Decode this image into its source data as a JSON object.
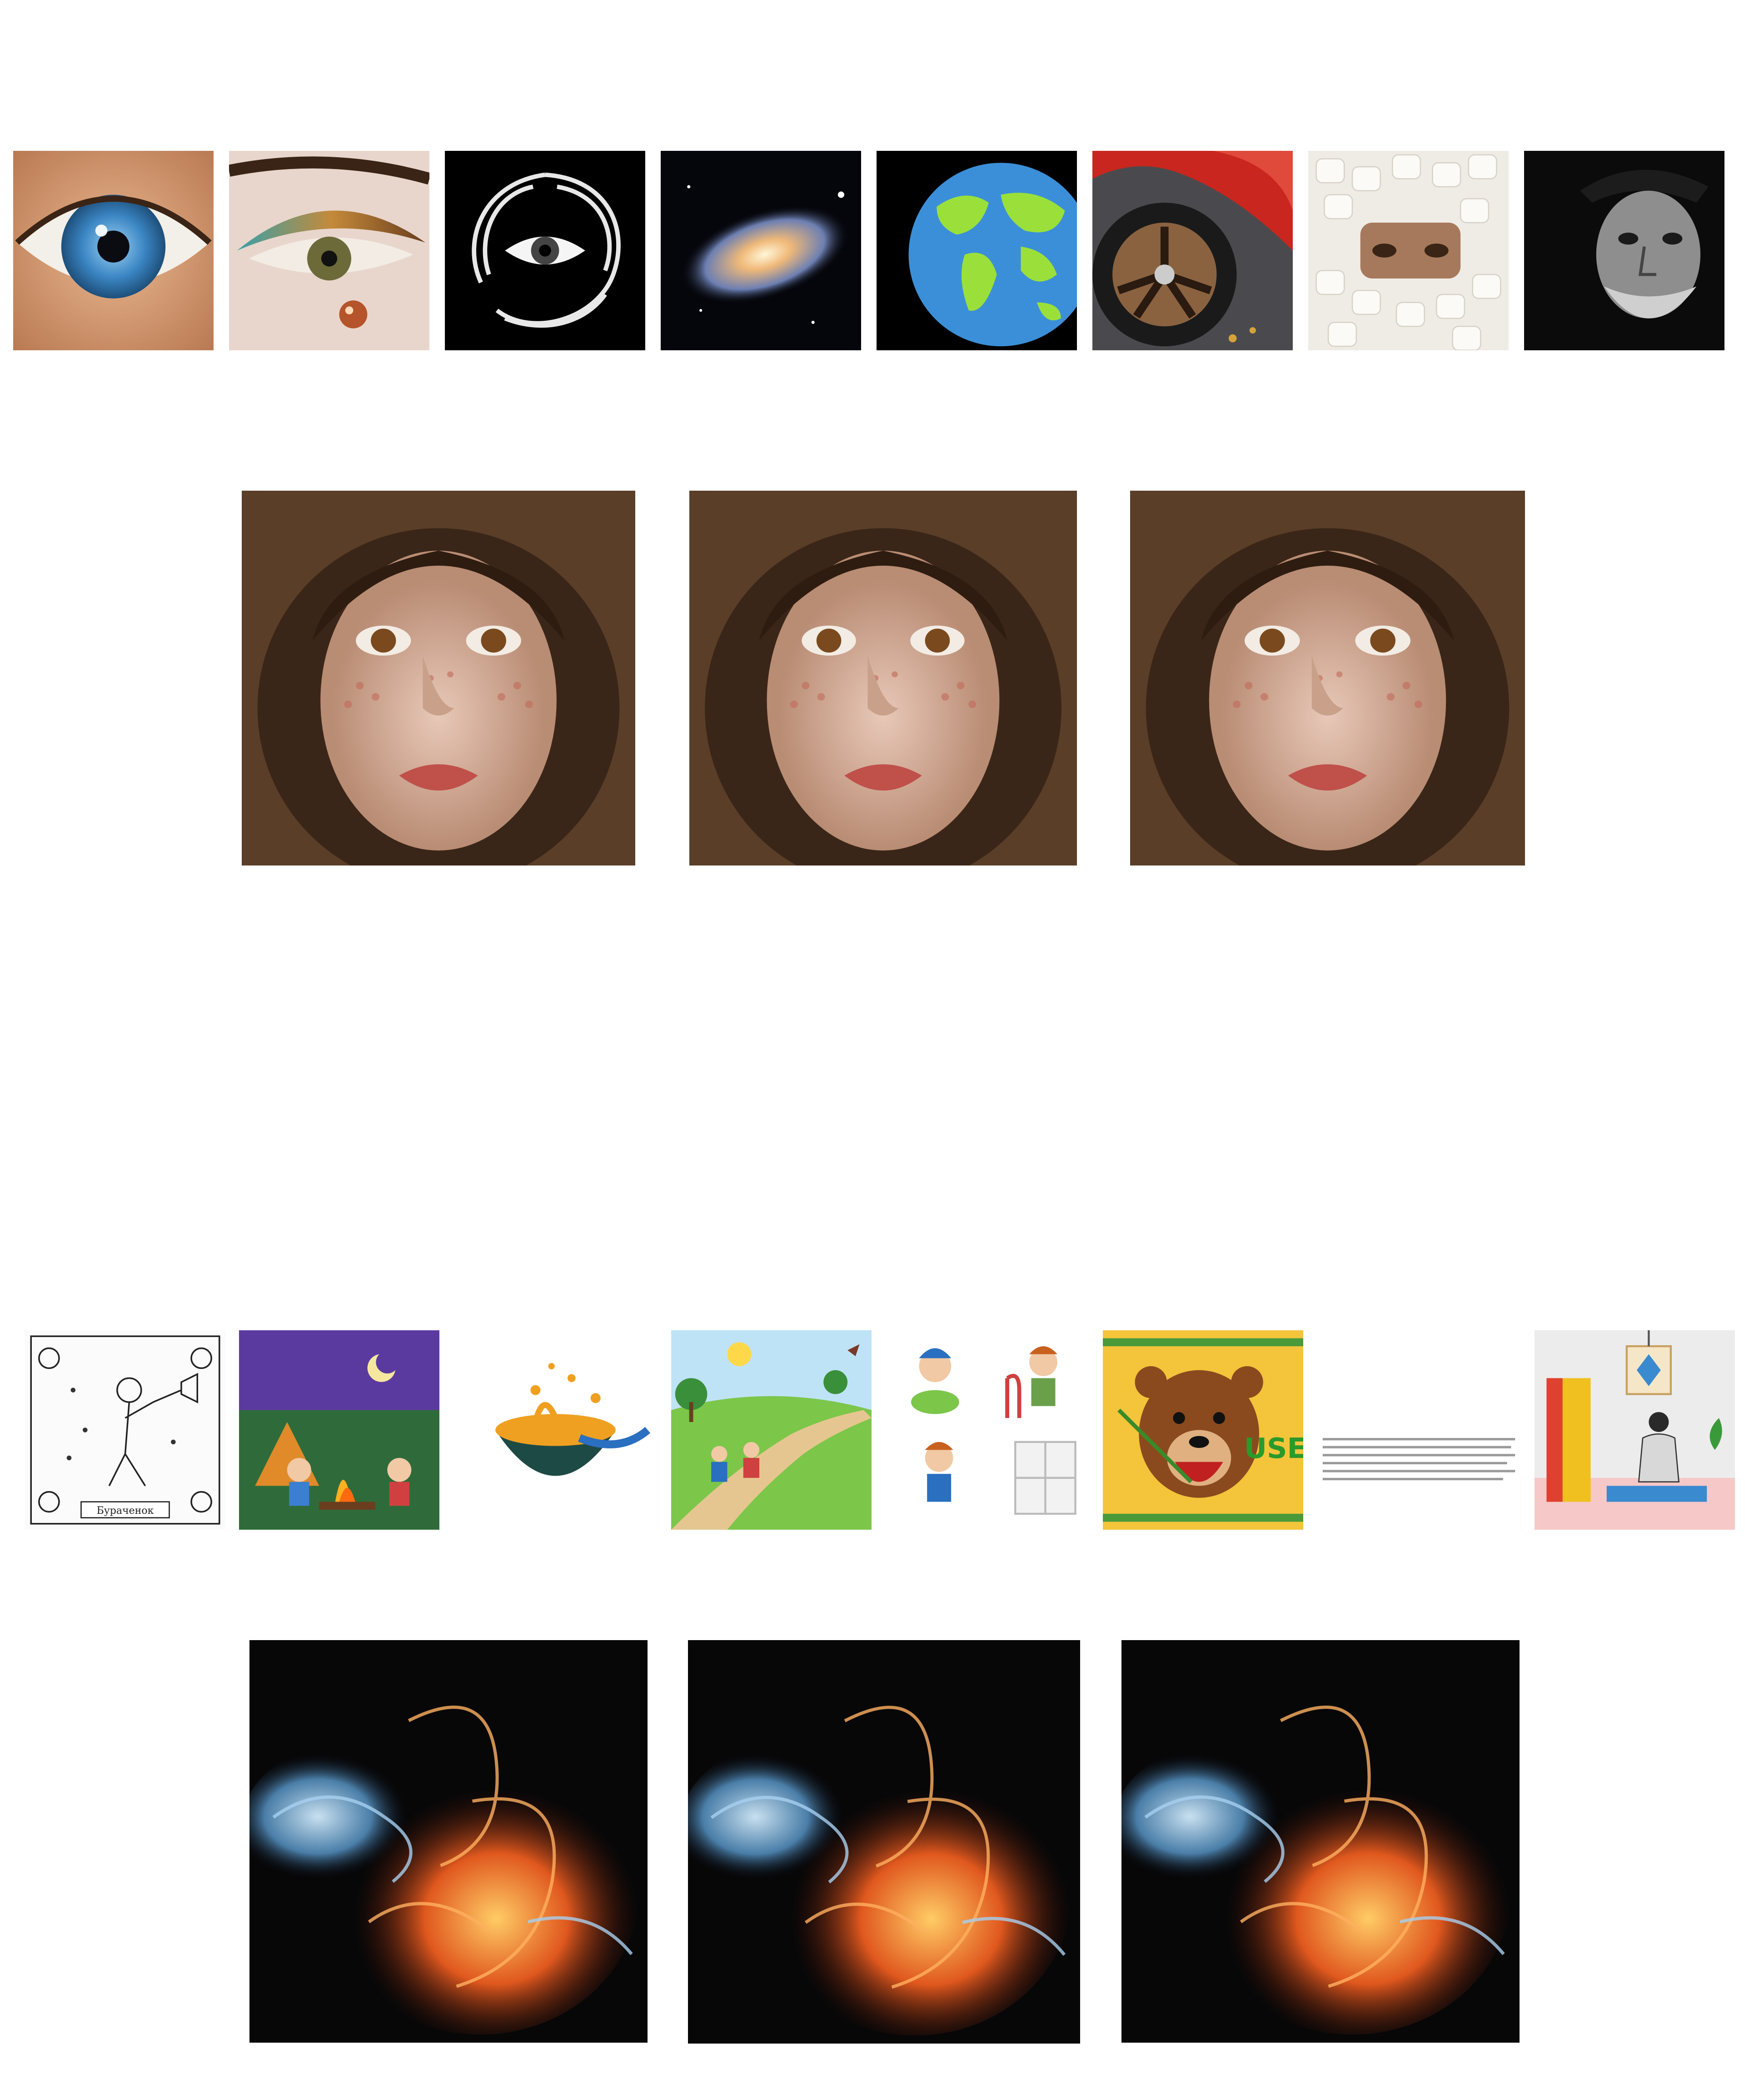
{
  "rows": [
    {
      "id": "row1",
      "items": [
        {
          "subject": "blue-eye-closeup"
        },
        {
          "subject": "gold-eyeshadow-eye-with-tear"
        },
        {
          "subject": "eye-inside-feather-swirl"
        },
        {
          "subject": "spiral-galaxy"
        },
        {
          "subject": "world-map-globe"
        },
        {
          "subject": "red-car-wheel"
        },
        {
          "subject": "eyes-among-marshmallows"
        },
        {
          "subject": "old-man-in-hat-portrait"
        }
      ]
    },
    {
      "id": "row2",
      "items": [
        {
          "subject": "freckled-girl-hood-portrait"
        },
        {
          "subject": "freckled-girl-hood-portrait"
        },
        {
          "subject": "freckled-girl-hood-portrait"
        }
      ]
    },
    {
      "id": "row3",
      "items": [
        {
          "subject": "line-art-man-with-trumpet",
          "caption": "Бураченок"
        },
        {
          "subject": "kids-campfire-night"
        },
        {
          "subject": "bowl-of-soup"
        },
        {
          "subject": "children-on-country-path"
        },
        {
          "subject": "boy-activities-grid"
        },
        {
          "subject": "roaring-bear-emblem",
          "caption": "USE"
        },
        {
          "subject": "faint-text-strip"
        },
        {
          "subject": "woman-yoga-room"
        }
      ]
    },
    {
      "id": "row4",
      "items": [
        {
          "subject": "fire-and-ice-swirl"
        },
        {
          "subject": "fire-and-ice-swirl"
        },
        {
          "subject": "fire-and-ice-swirl"
        }
      ]
    }
  ],
  "colors": {
    "background": "#ffffff"
  }
}
